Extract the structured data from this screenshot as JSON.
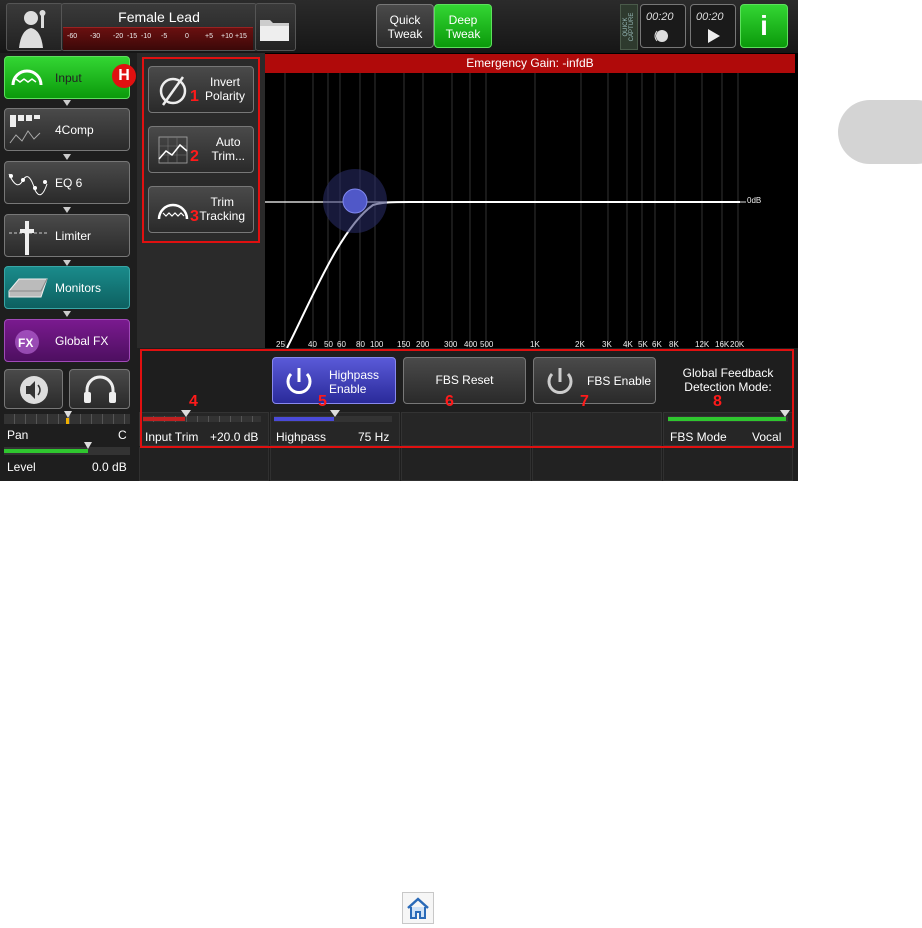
{
  "topbar": {
    "channel_name": "Female Lead",
    "meter_ticks": [
      "-60",
      "-30",
      "-20",
      "-15",
      "-10",
      "-5",
      "0",
      "+5",
      "+10",
      "+15"
    ],
    "quick_tweak": "Quick\nTweak",
    "deep_tweak": "Deep\nTweak",
    "quick_capture": "QUICK CAPTURE",
    "timer1": "00:20",
    "timer2": "00:20",
    "info": "i"
  },
  "chain": [
    {
      "label": "Input",
      "badge": "H"
    },
    {
      "label": "4Comp"
    },
    {
      "label": "EQ 6"
    },
    {
      "label": "Limiter"
    },
    {
      "label": "Monitors"
    },
    {
      "label": "Global FX"
    }
  ],
  "left_bottom": {
    "pan_label": "Pan",
    "pan_value": "C",
    "level_label": "Level",
    "level_value": "0.0 dB"
  },
  "fx_buttons": [
    {
      "label": "Invert\nPolarity",
      "num": "1"
    },
    {
      "label": "Auto\nTrim...",
      "num": "2"
    },
    {
      "label": "Trim\nTracking",
      "num": "3"
    }
  ],
  "graph": {
    "banner": "Emergency Gain: -infdB",
    "zero_label": "0dB",
    "freq_labels": [
      "25",
      "40",
      "50",
      "60",
      "80",
      "100",
      "150",
      "200",
      "300",
      "400",
      "500",
      "1K",
      "2K",
      "3K",
      "4K",
      "5K",
      "6K",
      "8K",
      "12K",
      "16K",
      "20K"
    ]
  },
  "controls": {
    "highpass_enable": "Highpass\nEnable",
    "fbs_reset": "FBS Reset",
    "fbs_enable": "FBS Enable",
    "global_feedback": "Global Feedback\nDetection Mode:",
    "input_trim_label": "Input Trim",
    "input_trim_value": "+20.0 dB",
    "highpass_label": "Highpass",
    "highpass_value": "75 Hz",
    "fbs_mode_label": "FBS Mode",
    "fbs_mode_value": "Vocal",
    "nums": [
      "4",
      "5",
      "6",
      "7",
      "8"
    ]
  }
}
